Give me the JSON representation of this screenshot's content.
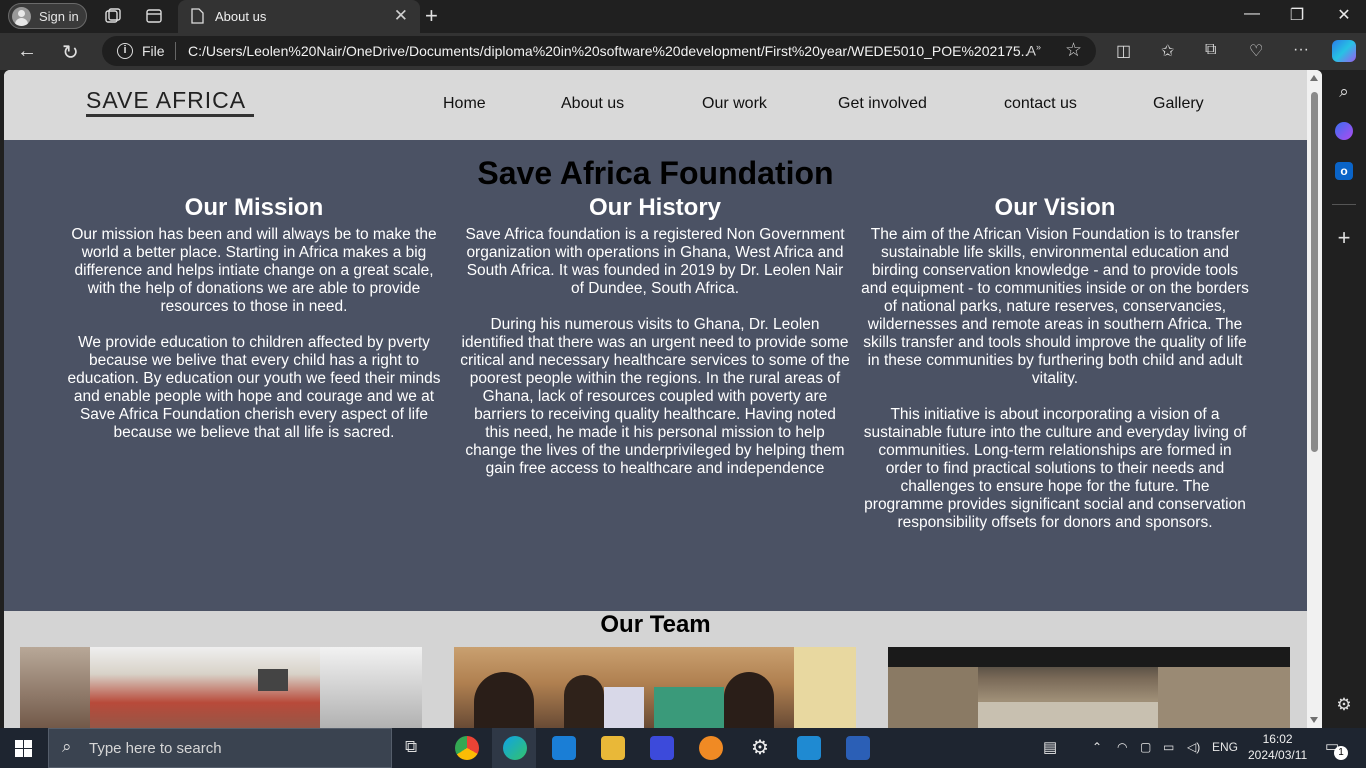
{
  "browser": {
    "signin_label": "Sign in",
    "tab_title": "About us",
    "address_scheme": "File",
    "address_path": "C:/Users/Leolen%20Nair/OneDrive/Documents/diploma%20in%20software%20development/First%20year/WEDE5010_POE%202175...",
    "accent": "#202020"
  },
  "site": {
    "logo": "SAVE AFRICA",
    "nav": [
      "Home",
      "About us",
      "Our work",
      "Get involved",
      "contact us",
      "Gallery"
    ],
    "page_title": "Save Africa Foundation",
    "columns": [
      {
        "title": "Our Mission",
        "paragraphs": [
          "Our mission has been and will always be to make the world a better place. Starting in Africa makes a big difference and helps intiate change on a great scale, with the help of donations we are able to provide resources to those in need.",
          "We provide education to children affected by pverty because we belive that every child has a right to education. By education our youth we feed their minds and enable people with hope and courage and we at Save Africa Foundation cherish every aspect of life because we believe that all life is sacred."
        ]
      },
      {
        "title": "Our History",
        "paragraphs": [
          "Save Africa foundation is a registered Non Government organization with operations in Ghana, West Africa and South Africa. It was founded in 2019 by Dr. Leolen Nair of Dundee, South Africa.",
          "During his numerous visits to Ghana, Dr. Leolen identified that there was an urgent need to provide some critical and necessary healthcare services to some of the poorest people within the regions. In the rural areas of Ghana, lack of resources coupled with poverty are barriers to receiving quality healthcare. Having noted this need, he made it his personal mission to help change the lives of the underprivileged by helping them gain free access to healthcare and independence"
        ]
      },
      {
        "title": "Our Vision",
        "paragraphs": [
          "The aim of the African Vision Foundation is to transfer sustainable life skills, environmental education and birding conservation knowledge - and to provide tools and equipment - to communities inside or on the borders of national parks, nature reserves, conservancies, wildernesses and remote areas in southern Africa. The skills transfer and tools should improve the quality of life in these communities by furthering both child and adult vitality.",
          "This initiative is about incorporating a vision of a sustainable future into the culture and everyday living of communities. Long-term relationships are formed in order to find practical solutions to their needs and challenges to ensure hope for the future. The programme provides significant social and conservation responsibility offsets for donors and sponsors."
        ]
      }
    ],
    "team_title": "Our Team",
    "colors": {
      "header_bg": "#d9d9d9",
      "main_bg": "#4b5264",
      "team_bg": "#d4d4d4"
    }
  },
  "taskbar": {
    "search_placeholder": "Type here to search",
    "language": "ENG",
    "time": "16:02",
    "date": "2024/03/11",
    "notification_count": "1"
  }
}
